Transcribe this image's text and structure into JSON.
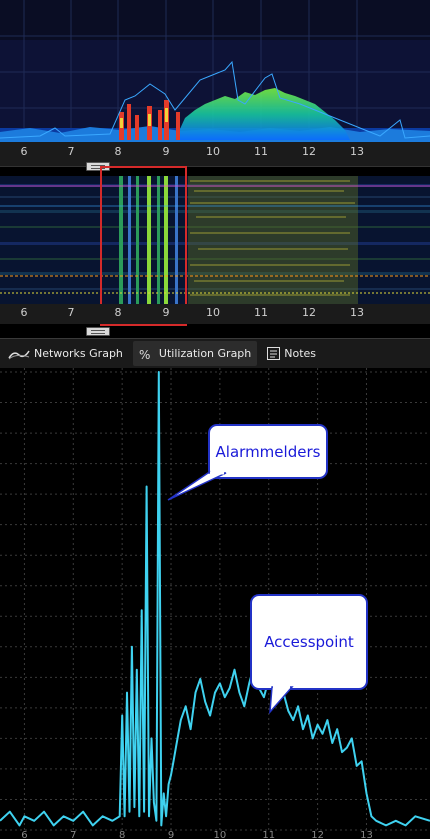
{
  "colors": {
    "trace": "#3fd2f0",
    "grid": "#3a3a3a",
    "selection": "#d52a2a",
    "callout_text": "#1a1ad8",
    "callout_border": "#2333c6"
  },
  "channel_axis": {
    "ticks": [
      "6",
      "7",
      "8",
      "9",
      "10",
      "11",
      "12",
      "13"
    ]
  },
  "tabs": [
    {
      "label": "Networks Graph",
      "icon": "networks-graph-icon",
      "active": false
    },
    {
      "label": "Utilization Graph",
      "icon": "utilization-graph-icon",
      "active": true
    },
    {
      "label": "Notes",
      "icon": "notes-icon",
      "active": false
    }
  ],
  "annotations": {
    "alarm": "Alarmmelders",
    "ap": "Accesspoint"
  },
  "chart_data": {
    "type": "line",
    "title": "",
    "xlabel": "",
    "ylabel": "",
    "xlim": [
      5.5,
      14.3
    ],
    "ylim": [
      0,
      100
    ],
    "x_ticks": [
      "6",
      "7",
      "8",
      "9",
      "10",
      "11",
      "12",
      "13"
    ],
    "series": [
      {
        "values_note": "",
        "x": [
          5.5,
          5.7,
          5.9,
          6.0,
          6.2,
          6.4,
          6.6,
          6.8,
          7.0,
          7.2,
          7.4,
          7.6,
          7.8,
          7.95,
          8.0,
          8.05,
          8.1,
          8.15,
          8.2,
          8.25,
          8.3,
          8.35,
          8.4,
          8.45,
          8.5,
          8.55,
          8.6,
          8.65,
          8.7,
          8.75,
          8.8,
          8.85,
          8.9,
          8.95,
          9.0,
          9.05,
          9.1,
          9.2,
          9.3,
          9.4,
          9.5,
          9.6,
          9.7,
          9.8,
          9.9,
          10.0,
          10.1,
          10.2,
          10.3,
          10.4,
          10.5,
          10.6,
          10.7,
          10.8,
          10.9,
          11.0,
          11.1,
          11.2,
          11.3,
          11.4,
          11.5,
          11.6,
          11.7,
          11.8,
          11.9,
          12.0,
          12.1,
          12.2,
          12.3,
          12.4,
          12.5,
          12.6,
          12.7,
          12.8,
          12.9,
          13.0,
          13.1,
          13.2,
          13.4,
          13.6,
          13.8,
          14.0,
          14.3
        ],
        "y": [
          2,
          4,
          1,
          3,
          2,
          4,
          1,
          3,
          2,
          4,
          1,
          3,
          2,
          3,
          25,
          3,
          30,
          4,
          40,
          5,
          35,
          3,
          48,
          4,
          75,
          3,
          20,
          6,
          2,
          100,
          1,
          8,
          3,
          10,
          12,
          15,
          18,
          24,
          27,
          22,
          30,
          33,
          28,
          25,
          30,
          32,
          29,
          31,
          35,
          30,
          27,
          32,
          36,
          31,
          29,
          33,
          34,
          28,
          30,
          26,
          24,
          27,
          22,
          25,
          20,
          23,
          21,
          24,
          19,
          22,
          17,
          18,
          20,
          14,
          15,
          8,
          3,
          2,
          1,
          2,
          1,
          3,
          2
        ]
      }
    ]
  }
}
